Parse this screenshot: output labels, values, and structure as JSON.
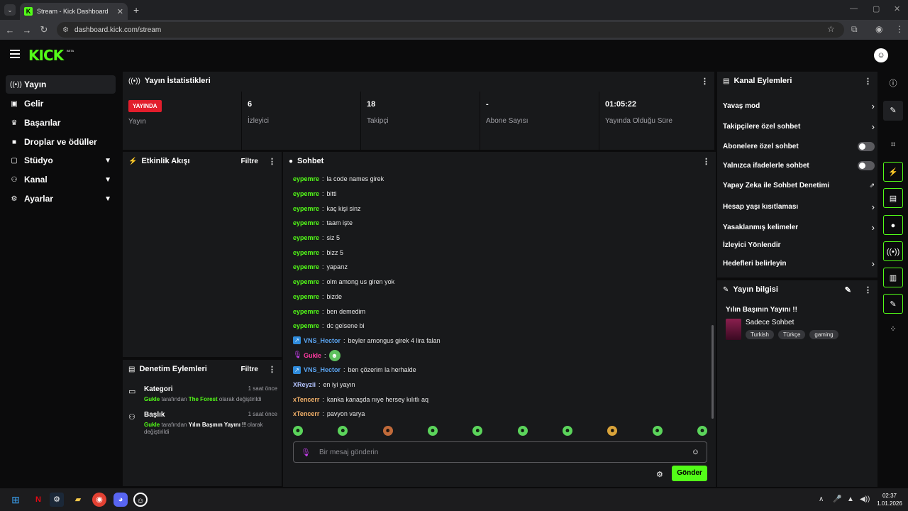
{
  "browser": {
    "tab_title": "Stream - Kick Dashboard",
    "url": "dashboard.kick.com/stream"
  },
  "header": {
    "logo": "KICK",
    "beta": "BETA"
  },
  "sidebar": {
    "items": [
      {
        "label": "Yayın",
        "icon": "broadcast-icon",
        "active": true
      },
      {
        "label": "Gelir",
        "icon": "income-icon"
      },
      {
        "label": "Başarılar",
        "icon": "trophy-icon"
      },
      {
        "label": "Droplar ve ödüller",
        "icon": "gift-icon"
      },
      {
        "label": "Stüdyo",
        "icon": "studio-icon",
        "expandable": true
      },
      {
        "label": "Kanal",
        "icon": "channel-icon",
        "expandable": true
      },
      {
        "label": "Ayarlar",
        "icon": "gear-icon",
        "expandable": true
      }
    ]
  },
  "stats": {
    "title": "Yayın İstatistikleri",
    "live_badge": "YAYINDA",
    "live_label": "Yayın",
    "viewers": {
      "value": "6",
      "label": "İzleyici"
    },
    "followers": {
      "value": "18",
      "label": "Takipçi"
    },
    "subs": {
      "value": "-",
      "label": "Abone Sayısı"
    },
    "uptime": {
      "value": "01:05:22",
      "label": "Yayında Olduğu Süre"
    }
  },
  "activity": {
    "title": "Etkinlik Akışı",
    "filter": "Filtre"
  },
  "moderation": {
    "title": "Denetim Eylemleri",
    "filter": "Filtre",
    "items": [
      {
        "title": "Kategori",
        "time": "1 saat önce",
        "user": "Gukle",
        "mid": "tarafından",
        "value": "The Forest",
        "end": "olarak değiştirildi"
      },
      {
        "title": "Başlık",
        "time": "1 saat önce",
        "user": "Gukle",
        "mid": "tarafından",
        "value": "Yılın Başının Yayını !!",
        "end": "olarak değiştirildi"
      }
    ]
  },
  "chat": {
    "title": "Sohbet",
    "messages": [
      {
        "user": "eypemre",
        "text": "la code names girek"
      },
      {
        "user": "eypemre",
        "text": "bitti"
      },
      {
        "user": "eypemre",
        "text": "kaç kişi sinz"
      },
      {
        "user": "eypemre",
        "text": "taam işte"
      },
      {
        "user": "eypemre",
        "text": "siz 5"
      },
      {
        "user": "eypemre",
        "text": "bizz 5"
      },
      {
        "user": "eypemre",
        "text": "yaparız"
      },
      {
        "user": "eypemre",
        "text": "olm among us giren yok"
      },
      {
        "user": "eypemre",
        "text": "bizde"
      },
      {
        "user": "eypemre",
        "text": "ben demedim"
      },
      {
        "user": "eypemre",
        "text": "dc gelsene bi"
      },
      {
        "user": "VNS_Hector",
        "text": "beyler amongus girek 4 lira falan"
      },
      {
        "user": "Gukle",
        "text": ""
      },
      {
        "user": "VNS_Hector",
        "text": "ben çözerim la herhalde"
      },
      {
        "user": "XReyzii",
        "text": "en iyi yayın"
      },
      {
        "user": "xTencerr",
        "text": "kanka kanaşda nıye hersey kılıtlı aq"
      },
      {
        "user": "xTencerr",
        "text": "pavyon varya"
      }
    ],
    "input_placeholder": "Bir mesaj gönderin",
    "send_label": "Gönder"
  },
  "channel_actions": {
    "title": "Kanal Eylemleri",
    "items": [
      {
        "label": "Yavaş mod",
        "control": "chevron"
      },
      {
        "label": "Takipçilere özel sohbet",
        "control": "chevron"
      },
      {
        "label": "Abonelere özel sohbet",
        "control": "toggle",
        "on": false
      },
      {
        "label": "Yalnızca ifadelerle sohbet",
        "control": "toggle",
        "on": false
      },
      {
        "label": "Yapay Zeka ile Sohbet Denetimi",
        "control": "external"
      },
      {
        "label": "Hesap yaşı kısıtlaması",
        "control": "chevron"
      },
      {
        "label": "Yasaklanmış kelimeler",
        "control": "chevron"
      },
      {
        "label": "İzleyici Yönlendir",
        "control": "none"
      },
      {
        "label": "Hedefleri belirleyin",
        "control": "chevron"
      }
    ]
  },
  "stream_info": {
    "title": "Yayın bilgisi",
    "stream_title": "Yılın Başının Yayını !!",
    "category": "Sadece Sohbet",
    "tags": [
      "Turkish",
      "Türkçe",
      "gaming"
    ]
  },
  "taskbar": {
    "time": "02:37",
    "date": "1.01.2026"
  },
  "colors": {
    "accent": "#53fc18",
    "live": "#e21d2c",
    "panel": "#18191b"
  }
}
